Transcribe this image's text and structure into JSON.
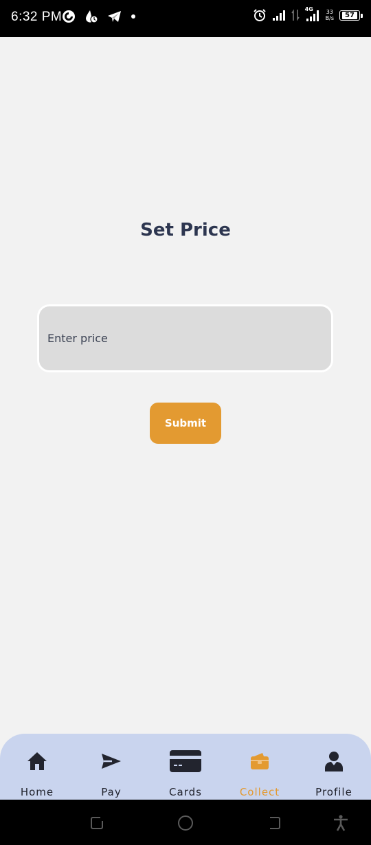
{
  "status_bar": {
    "time": "6:32 PM",
    "network_type": "4G",
    "data_speed_value": "33",
    "data_speed_unit": "B/s",
    "battery_level": "57"
  },
  "main": {
    "title": "Set Price",
    "price_input_placeholder": "Enter price",
    "price_input_value": "",
    "submit_label": "Submit"
  },
  "bottom_nav": {
    "items": [
      {
        "label": "Home",
        "icon": "home-icon"
      },
      {
        "label": "Pay",
        "icon": "send-icon"
      },
      {
        "label": "Cards",
        "icon": "card-icon"
      },
      {
        "label": "Collect",
        "icon": "wallet-icon",
        "active": true
      },
      {
        "label": "Profile",
        "icon": "profile-icon"
      }
    ],
    "active_color": "#e39a31",
    "inactive_color": "#22242e",
    "background_color": "#c9d4ee"
  },
  "colors": {
    "accent": "#e39a31",
    "title": "#2d3650",
    "background": "#f2f2f2",
    "input_background": "#dcdcdc"
  }
}
